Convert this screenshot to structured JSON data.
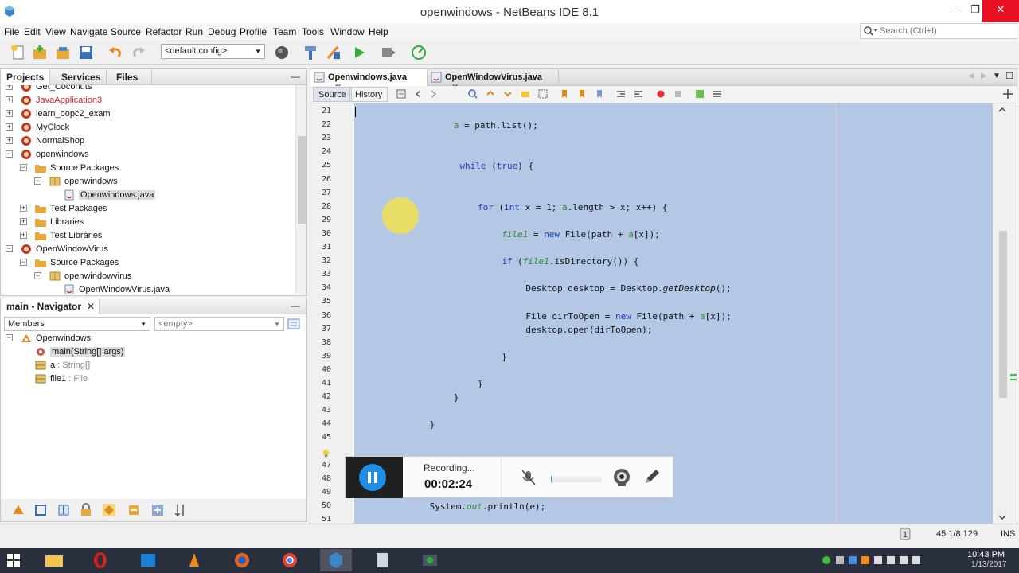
{
  "window": {
    "title": "openwindows - NetBeans IDE 8.1"
  },
  "menu": [
    "File",
    "Edit",
    "View",
    "Navigate",
    "Source",
    "Refactor",
    "Run",
    "Debug",
    "Profile",
    "Team",
    "Tools",
    "Window",
    "Help"
  ],
  "search": {
    "placeholder": "Search (Ctrl+I)"
  },
  "toolbar": {
    "config": "<default config>"
  },
  "projects_panel": {
    "tabs": [
      "Projects",
      "Services",
      "Files"
    ],
    "tree": [
      {
        "label": "Get_Coconuts",
        "depth": 0,
        "toggle": "+",
        "icon": "project"
      },
      {
        "label": "JavaApplication3",
        "depth": 0,
        "toggle": "+",
        "icon": "project",
        "error": true
      },
      {
        "label": "learn_oopc2_exam",
        "depth": 0,
        "toggle": "+",
        "icon": "project"
      },
      {
        "label": "MyClock",
        "depth": 0,
        "toggle": "+",
        "icon": "project"
      },
      {
        "label": "NormalShop",
        "depth": 0,
        "toggle": "+",
        "icon": "project"
      },
      {
        "label": "openwindows",
        "depth": 0,
        "toggle": "−",
        "icon": "project"
      },
      {
        "label": "Source Packages",
        "depth": 1,
        "toggle": "−",
        "icon": "folder"
      },
      {
        "label": "openwindows",
        "depth": 2,
        "toggle": "−",
        "icon": "package"
      },
      {
        "label": "Openwindows.java",
        "depth": 3,
        "toggle": "",
        "icon": "java",
        "selected": true
      },
      {
        "label": "Test Packages",
        "depth": 1,
        "toggle": "+",
        "icon": "folder"
      },
      {
        "label": "Libraries",
        "depth": 1,
        "toggle": "+",
        "icon": "folder"
      },
      {
        "label": "Test Libraries",
        "depth": 1,
        "toggle": "+",
        "icon": "folder"
      },
      {
        "label": "OpenWindowVirus",
        "depth": 0,
        "toggle": "−",
        "icon": "project"
      },
      {
        "label": "Source Packages",
        "depth": 1,
        "toggle": "−",
        "icon": "folder"
      },
      {
        "label": "openwindowvirus",
        "depth": 2,
        "toggle": "−",
        "icon": "package"
      },
      {
        "label": "OpenWindowVirus.java",
        "depth": 3,
        "toggle": "",
        "icon": "java"
      }
    ]
  },
  "navigator": {
    "title": "main - Navigator",
    "members_label": "Members",
    "filter": "<empty>",
    "items": [
      {
        "name": "Openwindows",
        "type": "",
        "depth": 0,
        "icon": "class"
      },
      {
        "name": "main(String[] args)",
        "type": "",
        "depth": 1,
        "icon": "method",
        "selected": true
      },
      {
        "name": "a",
        "type": " : String[]",
        "depth": 1,
        "icon": "field"
      },
      {
        "name": "file1",
        "type": " : File",
        "depth": 1,
        "icon": "field"
      }
    ]
  },
  "editor": {
    "tabs": [
      {
        "label": "Openwindows.java",
        "active": true
      },
      {
        "label": "OpenWindowVirus.java",
        "active": false
      }
    ],
    "source_label": "Source",
    "history_label": "History",
    "lines": [
      {
        "n": "21",
        "indent": 0,
        "parts": []
      },
      {
        "n": "22",
        "indent": 16,
        "parts": [
          [
            "fld",
            "a"
          ],
          [
            "",
            "= path.list();"
          ]
        ]
      },
      {
        "n": "23",
        "indent": 0,
        "parts": []
      },
      {
        "n": "24",
        "indent": 0,
        "parts": []
      },
      {
        "n": "25",
        "indent": 17,
        "parts": [
          [
            "kw",
            "while"
          ],
          [
            "",
            " ("
          ],
          [
            "kw",
            "true"
          ],
          [
            "",
            ") {"
          ]
        ]
      },
      {
        "n": "26",
        "indent": 0,
        "parts": []
      },
      {
        "n": "27",
        "indent": 0,
        "parts": []
      },
      {
        "n": "28",
        "indent": 20,
        "parts": [
          [
            "kw",
            "for"
          ],
          [
            "",
            " ("
          ],
          [
            "kw",
            "int"
          ],
          [
            "",
            " x = 1; "
          ],
          [
            "fld",
            "a"
          ],
          [
            "",
            ".length > x; x++) {"
          ]
        ]
      },
      {
        "n": "29",
        "indent": 0,
        "parts": []
      },
      {
        "n": "30",
        "indent": 24,
        "parts": [
          [
            "it",
            "file1"
          ],
          [
            "",
            " = "
          ],
          [
            "kw",
            "new"
          ],
          [
            "",
            " File(path + "
          ],
          [
            "fld",
            "a"
          ],
          [
            "",
            "[x]);"
          ]
        ]
      },
      {
        "n": "31",
        "indent": 0,
        "parts": []
      },
      {
        "n": "32",
        "indent": 24,
        "parts": [
          [
            "kw",
            "if"
          ],
          [
            "",
            " ("
          ],
          [
            "it",
            "file1"
          ],
          [
            "",
            ".isDirectory()) {"
          ]
        ]
      },
      {
        "n": "33",
        "indent": 0,
        "parts": []
      },
      {
        "n": "34",
        "indent": 28,
        "parts": [
          [
            "",
            "Desktop desktop = Desktop."
          ],
          [
            "mth",
            "getDesktop"
          ],
          [
            "",
            "();"
          ]
        ]
      },
      {
        "n": "35",
        "indent": 0,
        "parts": []
      },
      {
        "n": "36",
        "indent": 28,
        "parts": [
          [
            "",
            "File dirToOpen = "
          ],
          [
            "kw",
            "new"
          ],
          [
            "",
            " File(path + "
          ],
          [
            "fld",
            "a"
          ],
          [
            "",
            "[x]);"
          ]
        ]
      },
      {
        "n": "37",
        "indent": 28,
        "parts": [
          [
            "",
            "desktop.open(dirToOpen);"
          ]
        ]
      },
      {
        "n": "38",
        "indent": 0,
        "parts": []
      },
      {
        "n": "39",
        "indent": 24,
        "parts": [
          [
            "",
            "}"
          ]
        ]
      },
      {
        "n": "40",
        "indent": 0,
        "parts": []
      },
      {
        "n": "41",
        "indent": 20,
        "parts": [
          [
            "",
            "}"
          ]
        ]
      },
      {
        "n": "42",
        "indent": 16,
        "parts": [
          [
            "",
            "}"
          ]
        ]
      },
      {
        "n": "43",
        "indent": 0,
        "parts": []
      },
      {
        "n": "44",
        "indent": 12,
        "parts": [
          [
            "",
            "}"
          ]
        ]
      },
      {
        "n": "45",
        "indent": 0,
        "parts": []
      },
      {
        "n": "",
        "indent": 0,
        "parts": []
      },
      {
        "n": "47",
        "indent": 0,
        "parts": []
      },
      {
        "n": "48",
        "indent": 0,
        "parts": []
      },
      {
        "n": "49",
        "indent": 0,
        "parts": []
      },
      {
        "n": "50",
        "indent": 12,
        "parts": [
          [
            "",
            "System."
          ],
          [
            "it",
            "out"
          ],
          [
            "",
            ".println(e);"
          ]
        ]
      },
      {
        "n": "51",
        "indent": 0,
        "parts": []
      }
    ]
  },
  "recorder": {
    "status": "Recording...",
    "time": "00:02:24",
    "mic_level": 0.02
  },
  "statusbar": {
    "position": "45:1/8:129",
    "mode": "INS"
  },
  "taskbar": {
    "time": "10:43 PM",
    "date": "1/13/2017"
  },
  "colors": {
    "selection": "#b4c8e6",
    "keyword": "#1a3fb8",
    "field": "#2f8a2f",
    "recorder_accent": "#1f8ee6",
    "close_button": "#e81123"
  }
}
